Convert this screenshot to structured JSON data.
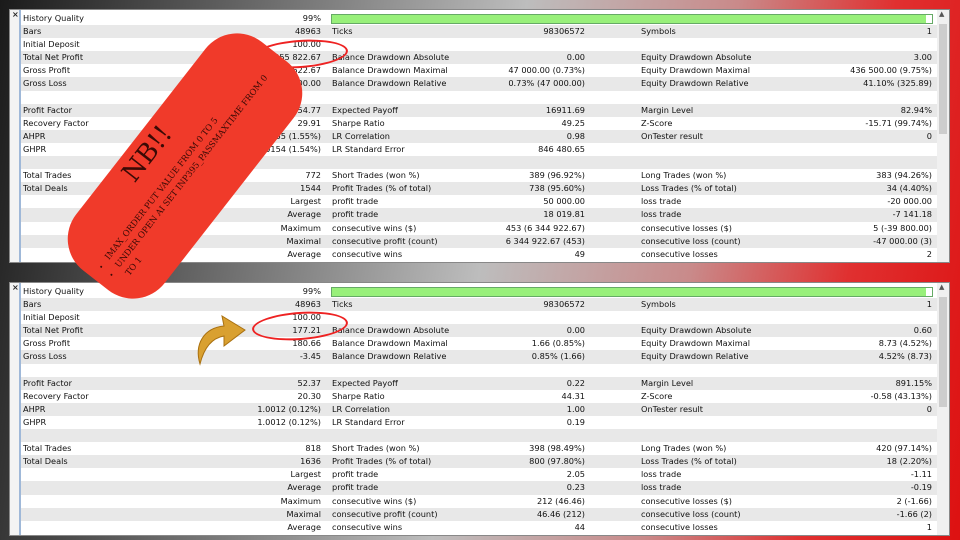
{
  "colors": {
    "bar": "#98f07a",
    "ellipse": "#e22222",
    "tag": "#f03a2a",
    "arrow": "#d9a030"
  },
  "close_icon": "×",
  "panels": [
    {
      "progress_percent": 99,
      "rows": [
        [
          "History Quality",
          "99%",
          "",
          "",
          "",
          ""
        ],
        [
          "Bars",
          "48963",
          "Ticks",
          "98306572",
          "Symbols",
          "1"
        ],
        [
          "Initial Deposit",
          "100.00",
          "",
          "",
          "",
          ""
        ],
        [
          "Total Net Profit",
          "13 055 822.67",
          "Balance Drawdown Absolute",
          "0.00",
          "Equity Drawdown Absolute",
          "3.00"
        ],
        [
          "Gross Profit",
          "13 298 622.67",
          "Balance Drawdown Maximal",
          "47 000.00 (0.73%)",
          "Equity Drawdown Maximal",
          "436 500.00 (9.75%)"
        ],
        [
          "Gross Loss",
          "-242 800.00",
          "Balance Drawdown Relative",
          "0.73% (47 000.00)",
          "Equity Drawdown Relative",
          "41.10% (325.89)"
        ],
        [
          "",
          "",
          "",
          "",
          "",
          ""
        ],
        [
          "Profit Factor",
          "54.77",
          "Expected Payoff",
          "16911.69",
          "Margin Level",
          "82.94%"
        ],
        [
          "Recovery Factor",
          "29.91",
          "Sharpe Ratio",
          "49.25",
          "Z-Score",
          "-15.71 (99.74%)"
        ],
        [
          "AHPR",
          "1.0155 (1.55%)",
          "LR Correlation",
          "0.98",
          "OnTester result",
          "0"
        ],
        [
          "GHPR",
          "1.0154 (1.54%)",
          "LR Standard Error",
          "846 480.65",
          "",
          ""
        ],
        [
          "",
          "",
          "",
          "",
          "",
          ""
        ],
        [
          "Total Trades",
          "772",
          "Short Trades (won %)",
          "389 (96.92%)",
          "Long Trades (won %)",
          "383 (94.26%)"
        ],
        [
          "Total Deals",
          "1544",
          "Profit Trades (% of total)",
          "738 (95.60%)",
          "Loss Trades (% of total)",
          "34 (4.40%)"
        ],
        [
          "",
          "Largest",
          "profit trade",
          "50 000.00",
          "loss trade",
          "-20 000.00"
        ],
        [
          "",
          "Average",
          "profit trade",
          "18 019.81",
          "loss trade",
          "-7 141.18"
        ],
        [
          "",
          "Maximum",
          "consecutive wins ($)",
          "453 (6 344 922.67)",
          "consecutive losses ($)",
          "5 (-39 800.00)"
        ],
        [
          "",
          "Maximal",
          "consecutive profit (count)",
          "6 344 922.67 (453)",
          "consecutive loss (count)",
          "-47 000.00 (3)"
        ],
        [
          "",
          "Average",
          "consecutive wins",
          "49",
          "consecutive losses",
          "2"
        ]
      ]
    },
    {
      "progress_percent": 99,
      "rows": [
        [
          "History Quality",
          "99%",
          "",
          "",
          "",
          ""
        ],
        [
          "Bars",
          "48963",
          "Ticks",
          "98306572",
          "Symbols",
          "1"
        ],
        [
          "Initial Deposit",
          "100.00",
          "",
          "",
          "",
          ""
        ],
        [
          "Total Net Profit",
          "177.21",
          "Balance Drawdown Absolute",
          "0.00",
          "Equity Drawdown Absolute",
          "0.60"
        ],
        [
          "Gross Profit",
          "180.66",
          "Balance Drawdown Maximal",
          "1.66 (0.85%)",
          "Equity Drawdown Maximal",
          "8.73 (4.52%)"
        ],
        [
          "Gross Loss",
          "-3.45",
          "Balance Drawdown Relative",
          "0.85% (1.66)",
          "Equity Drawdown Relative",
          "4.52% (8.73)"
        ],
        [
          "",
          "",
          "",
          "",
          "",
          ""
        ],
        [
          "Profit Factor",
          "52.37",
          "Expected Payoff",
          "0.22",
          "Margin Level",
          "891.15%"
        ],
        [
          "Recovery Factor",
          "20.30",
          "Sharpe Ratio",
          "44.31",
          "Z-Score",
          "-0.58 (43.13%)"
        ],
        [
          "AHPR",
          "1.0012 (0.12%)",
          "LR Correlation",
          "1.00",
          "OnTester result",
          "0"
        ],
        [
          "GHPR",
          "1.0012 (0.12%)",
          "LR Standard Error",
          "0.19",
          "",
          ""
        ],
        [
          "",
          "",
          "",
          "",
          "",
          ""
        ],
        [
          "Total Trades",
          "818",
          "Short Trades (won %)",
          "398 (98.49%)",
          "Long Trades (won %)",
          "420 (97.14%)"
        ],
        [
          "Total Deals",
          "1636",
          "Profit Trades (% of total)",
          "800 (97.80%)",
          "Loss Trades (% of total)",
          "18 (2.20%)"
        ],
        [
          "",
          "Largest",
          "profit trade",
          "2.05",
          "loss trade",
          "-1.11"
        ],
        [
          "",
          "Average",
          "profit trade",
          "0.23",
          "loss trade",
          "-0.19"
        ],
        [
          "",
          "Maximum",
          "consecutive wins ($)",
          "212 (46.46)",
          "consecutive losses ($)",
          "2 (-1.66)"
        ],
        [
          "",
          "Maximal",
          "consecutive profit (count)",
          "46.46 (212)",
          "consecutive loss (count)",
          "-1.66 (2)"
        ],
        [
          "",
          "Average",
          "consecutive wins",
          "44",
          "consecutive losses",
          "1"
        ]
      ]
    }
  ],
  "note": {
    "title": "NB!!",
    "bullets": [
      "iMAX_ORDER PUT VALUE FROM 0 TO 5",
      "UNDER OPEN AI SET INP395_PASSMAXTIME FROM 0 TO 1"
    ]
  }
}
